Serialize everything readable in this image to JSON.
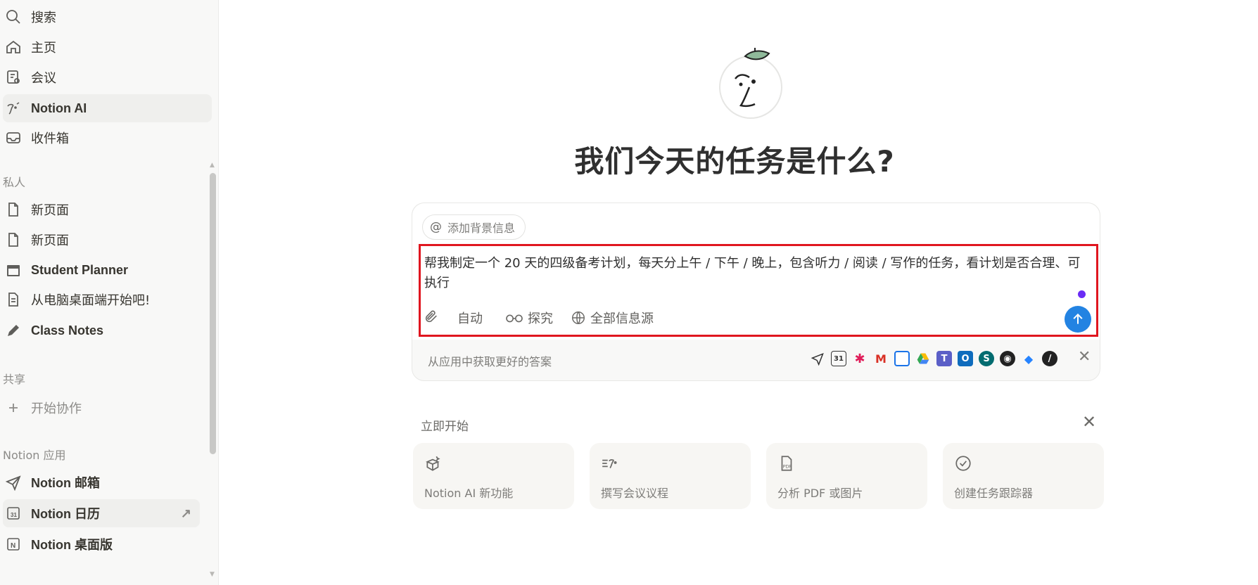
{
  "sidebar": {
    "nav": [
      {
        "label": "搜索",
        "icon": "search-icon"
      },
      {
        "label": "主页",
        "icon": "home-icon"
      },
      {
        "label": "会议",
        "icon": "meeting-icon"
      },
      {
        "label": "Notion AI",
        "icon": "notion-ai-icon"
      },
      {
        "label": "收件箱",
        "icon": "inbox-icon"
      }
    ],
    "section_private": "私人",
    "private_pages": [
      {
        "label": "新页面",
        "icon": "page-icon"
      },
      {
        "label": "新页面",
        "icon": "page-icon"
      },
      {
        "label": "Student Planner",
        "icon": "calendar-page-icon"
      },
      {
        "label": "从电脑桌面端开始吧!",
        "icon": "document-icon"
      },
      {
        "label": "Class Notes",
        "icon": "pencil-icon"
      }
    ],
    "section_shared": "共享",
    "shared_action": "开始协作",
    "section_apps": "Notion 应用",
    "apps": [
      {
        "label": "Notion 邮箱",
        "icon": "send-icon"
      },
      {
        "label": "Notion 日历",
        "icon": "calendar-icon"
      },
      {
        "label": "Notion 桌面版",
        "icon": "notion-icon"
      }
    ]
  },
  "main": {
    "headline": "我们今天的任务是什么?",
    "composer": {
      "context_chip": "添加背景信息",
      "context_at": "@",
      "prompt": "帮我制定一个 20 天的四级备考计划，每天分上午 / 下午 / 晚上，包含听力 / 阅读 / 写作的任务，看计划是否合理、可执行",
      "mode": "自动",
      "research": "探究",
      "sources": "全部信息源",
      "apps_hint": "从应用中获取更好的答案"
    },
    "start": {
      "label": "立即开始",
      "cards": [
        {
          "label": "Notion AI 新功能",
          "icon": "sparkle-box-icon"
        },
        {
          "label": "撰写会议议程",
          "icon": "agenda-icon"
        },
        {
          "label": "分析 PDF 或图片",
          "icon": "pdf-icon"
        },
        {
          "label": "创建任务跟踪器",
          "icon": "check-circle-icon"
        }
      ]
    }
  },
  "colors": {
    "accent": "#2383e2",
    "highlight": "#e0161f",
    "sidebar_bg": "#f8f8f7"
  }
}
